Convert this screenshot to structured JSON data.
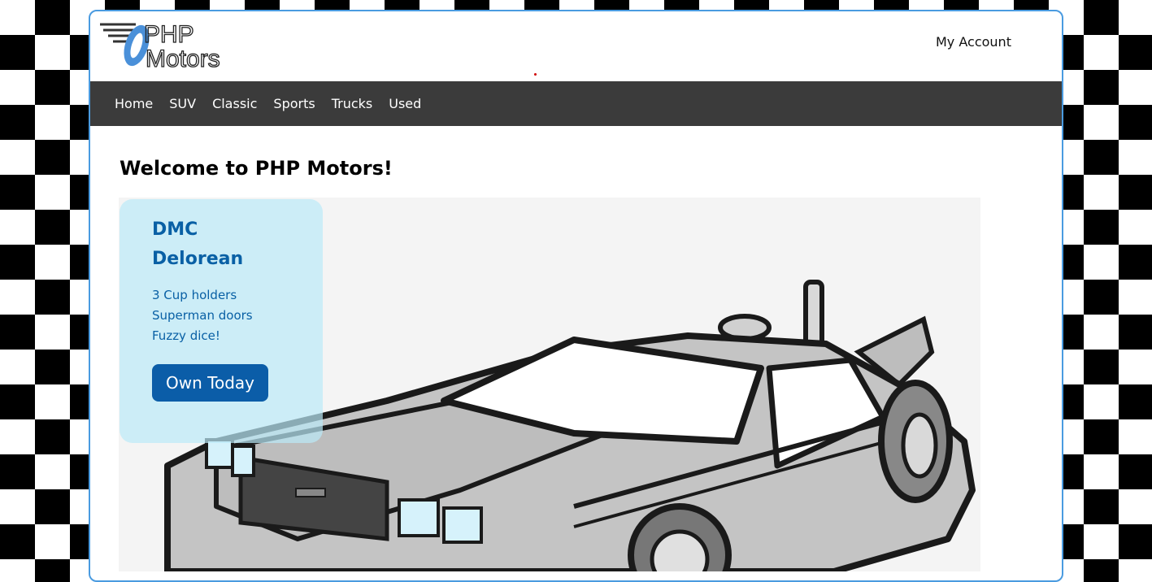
{
  "header": {
    "logo": {
      "text_top": "PHP",
      "text_bottom": "Motors"
    },
    "account_link": "My Account"
  },
  "nav": {
    "items": [
      {
        "label": "Home"
      },
      {
        "label": "SUV"
      },
      {
        "label": "Classic"
      },
      {
        "label": "Sports"
      },
      {
        "label": "Trucks"
      },
      {
        "label": "Used"
      }
    ]
  },
  "main": {
    "title": "Welcome to PHP Motors!",
    "feature": {
      "name": "DMC Delorean",
      "features": [
        "3 Cup holders",
        "Superman doors",
        "Fuzzy dice!"
      ],
      "button": "Own Today"
    }
  },
  "colors": {
    "frame_border": "#4a9be0",
    "nav_background": "#3b3b3b",
    "feature_text": "#0960a5",
    "button_background": "#0b5da8",
    "logo_blue": "#4a90d9"
  },
  "icons": {
    "logo": "php-motors-logo-icon",
    "hero": "delorean-car-illustration"
  }
}
